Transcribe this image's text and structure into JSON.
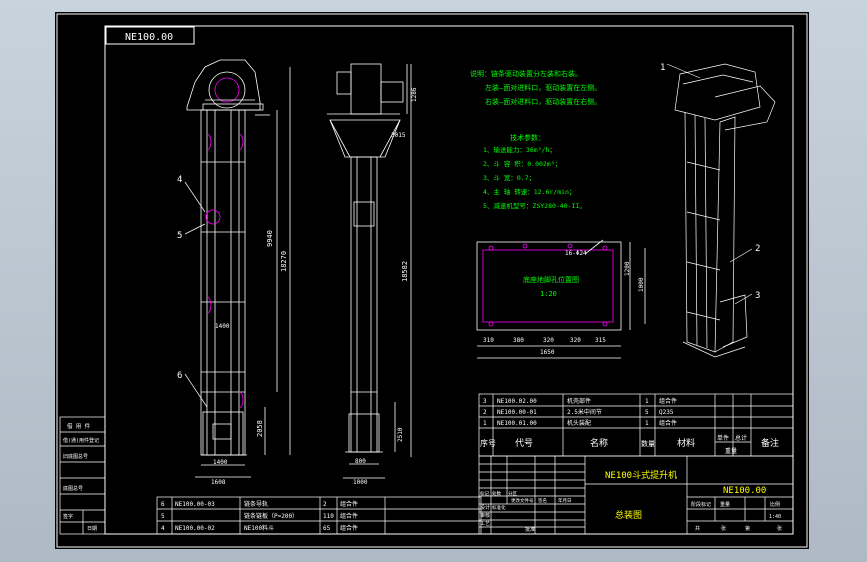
{
  "drawing": {
    "code_box": "NE100.00",
    "callouts": [
      "4",
      "5",
      "6",
      "1",
      "2",
      "3"
    ],
    "dims_front": {
      "total_h": "18270",
      "mid_h": "9940",
      "bottom_h": "2058",
      "inner_w": "1400",
      "outer_w": "1608",
      "lower_w": "1400"
    },
    "dims_side": {
      "total_h": "18582",
      "top_h": "1286",
      "head_w": "3015",
      "bottom_h": "2510",
      "inner_w": "800",
      "outer_w": "1000"
    },
    "notes": {
      "title": "说明：链条驱动装置分左装和右装。",
      "left": "左装—面对进料口，驱动装置在左侧。",
      "right": "右装—面对进料口，驱动装置在右侧。",
      "tech_title": "技术参数：",
      "items": [
        "1、输送能力：36m³/h；",
        "2、斗 容 积：0.002m³；",
        "3、斗 宽：0.7；",
        "4、主 轴 转速：12.6r/min；",
        "5、减速机型号：ZSY280-40-II。"
      ]
    },
    "plan": {
      "label": "16-Φ24",
      "caption": "底座地脚孔位置图",
      "scale": "1:20",
      "dims_bottom": [
        "310",
        "380",
        "320",
        "320",
        "315"
      ],
      "total": "1650",
      "side_dims": [
        "1200",
        "1000"
      ]
    }
  },
  "parts_upper": {
    "rows": [
      {
        "no": "3",
        "code": "NE100.02.00",
        "name": "机壳部件",
        "qty": "1",
        "mat": "组合件"
      },
      {
        "no": "2",
        "code": "NE100.00-01",
        "name": "2.5米中间节",
        "qty": "5",
        "mat": "Q235"
      },
      {
        "no": "1",
        "code": "NE100.01.00",
        "name": "机头装配",
        "qty": "1",
        "mat": "组合件"
      }
    ],
    "header": {
      "no": "序号",
      "code": "代号",
      "name": "名称",
      "qty": "数量",
      "mat": "材料",
      "unit": "单件",
      "total": "总计",
      "weight": "重量",
      "remark": "备注"
    }
  },
  "parts_lower": {
    "rows": [
      {
        "no": "6",
        "code": "NE100.00-03",
        "name": "链条导轨",
        "qty": "2",
        "mat": "组合件"
      },
      {
        "no": "5",
        "code": "",
        "name": "链条链板（P=200）",
        "qty": "110",
        "mat": "组合件"
      },
      {
        "no": "4",
        "code": "NE100.00-02",
        "name": "NE100料斗",
        "qty": "65",
        "mat": "组合件"
      }
    ]
  },
  "title_block": {
    "product": "NE100斗式提升机",
    "drawing_no": "NE100.00",
    "kind": "总装图",
    "scale": "1:40",
    "labels": [
      "标记",
      "处数",
      "分区",
      "更改文件号",
      "签名",
      "年月日"
    ],
    "roles": [
      "设计",
      "标准化",
      "审核",
      "工艺",
      "批准"
    ],
    "stage": [
      "阶段标记",
      "重量",
      "比例"
    ],
    "sheet": [
      "共",
      "张",
      "第",
      "张"
    ]
  },
  "left_stamp": {
    "rows": [
      "借(通)用件登记",
      "旧底图总号",
      "底图总号",
      "签字",
      "日期"
    ],
    "top": "借 用 件"
  }
}
